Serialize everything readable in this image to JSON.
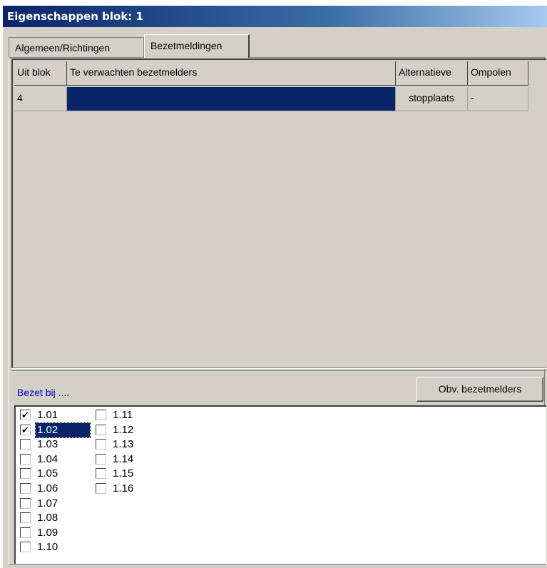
{
  "window": {
    "title": "Eigenschappen blok: 1"
  },
  "tabs": [
    {
      "label": "Algemeen/Richtingen",
      "active": false
    },
    {
      "label": "Bezetmeldingen",
      "active": true
    }
  ],
  "grid": {
    "columns": [
      "Uit blok",
      "Te verwachten bezetmelders",
      "Alternatieve",
      "Ompolen"
    ],
    "rows": [
      {
        "uit_blok": "4",
        "te_verwachten": "",
        "alternatieve": "stopplaats",
        "ompolen": "-"
      }
    ],
    "selected_color": "#0a246a"
  },
  "bezet": {
    "label": "Bezet bij ....",
    "button_label": "Obv. bezetmelders",
    "items": [
      {
        "label": "1.01",
        "checked": true
      },
      {
        "label": "1.02",
        "checked": true,
        "selected": true
      },
      {
        "label": "1.03",
        "checked": false
      },
      {
        "label": "1.04",
        "checked": false
      },
      {
        "label": "1.05",
        "checked": false
      },
      {
        "label": "1.06",
        "checked": false
      },
      {
        "label": "1.07",
        "checked": false
      },
      {
        "label": "1.08",
        "checked": false
      },
      {
        "label": "1.09",
        "checked": false
      },
      {
        "label": "1.10",
        "checked": false
      },
      {
        "label": "1.11",
        "checked": false
      },
      {
        "label": "1.12",
        "checked": false
      },
      {
        "label": "1.13",
        "checked": false
      },
      {
        "label": "1.14",
        "checked": false
      },
      {
        "label": "1.15",
        "checked": false
      },
      {
        "label": "1.16",
        "checked": false
      }
    ]
  },
  "colors": {
    "title_bar": "#0a246a",
    "face": "#d4d0c8",
    "link_text": "#0000c0"
  }
}
